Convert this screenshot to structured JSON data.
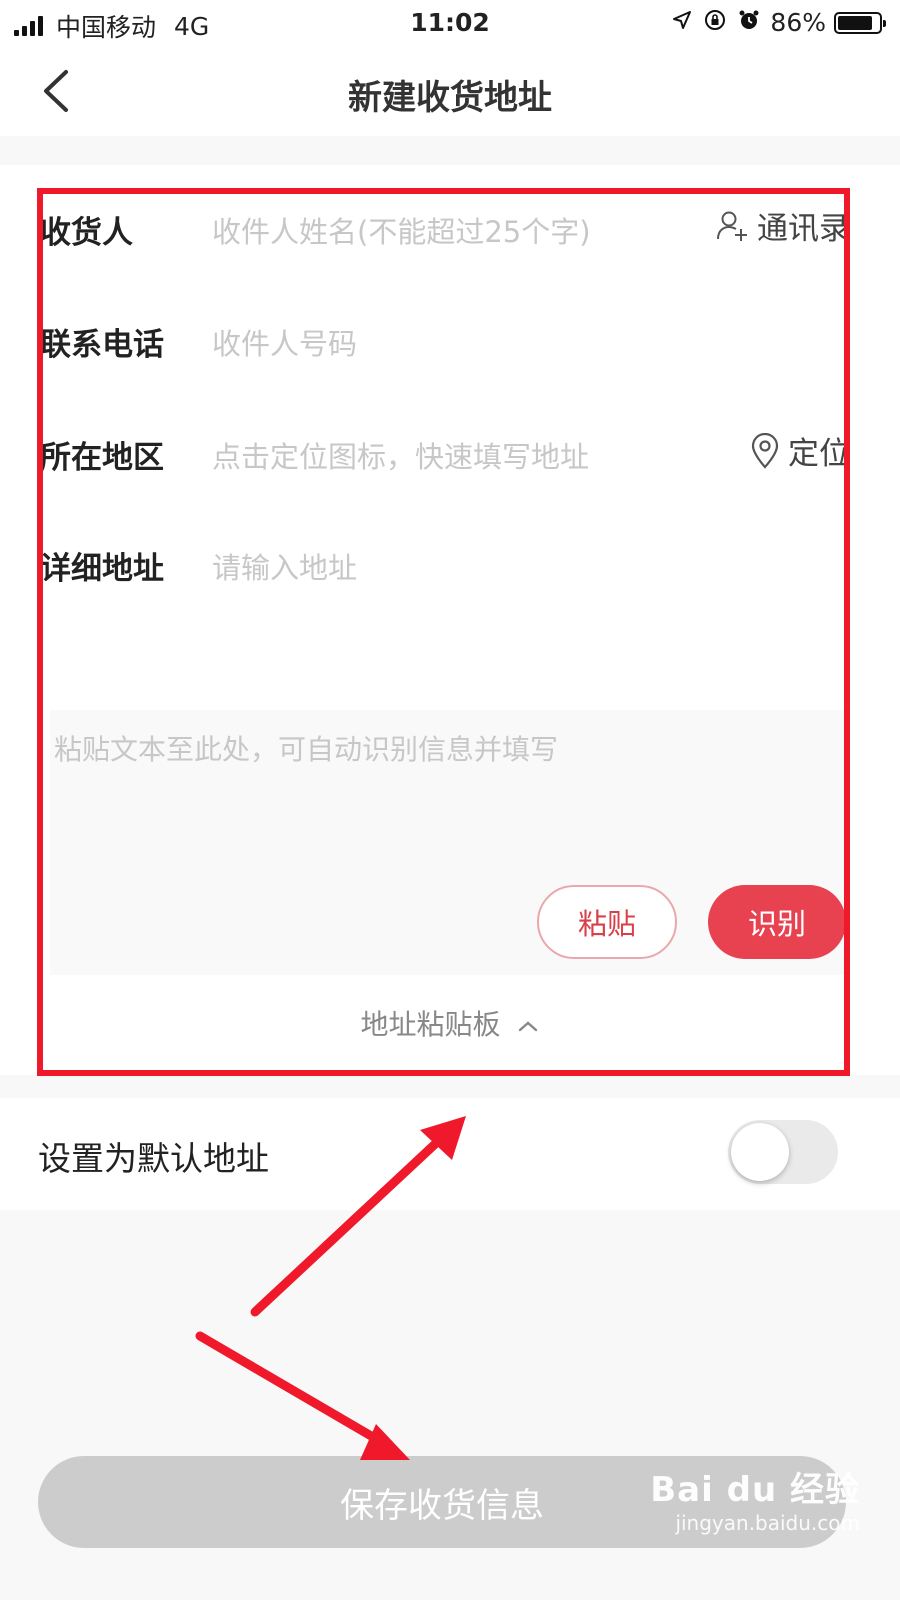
{
  "status_bar": {
    "carrier": "中国移动",
    "network": "4G",
    "time": "11:02",
    "battery": "86%",
    "battery_level": 0.86,
    "icons": [
      "location-arrow-icon",
      "orientation-lock-icon",
      "alarm-icon"
    ]
  },
  "nav": {
    "title": "新建收货地址",
    "back_icon": "chevron-left-icon"
  },
  "form": {
    "receiver": {
      "label": "收货人",
      "placeholder": "收件人姓名(不能超过25个字)",
      "action": "通讯录",
      "action_icon": "contact-add-icon"
    },
    "phone": {
      "label": "联系电话",
      "placeholder": "收件人号码"
    },
    "region": {
      "label": "所在地区",
      "placeholder": "点击定位图标，快速填写地址",
      "action": "定位",
      "action_icon": "location-pin-icon"
    },
    "detail": {
      "label": "详细地址",
      "placeholder": "请输入地址"
    }
  },
  "clipboard": {
    "hint": "粘贴文本至此处，可自动识别信息并填写",
    "paste_label": "粘贴",
    "recognize_label": "识别",
    "toggle_label": "地址粘贴板",
    "toggle_icon": "chevron-up-icon"
  },
  "default_address": {
    "label": "设置为默认地址",
    "enabled": false
  },
  "save_label": "保存收货信息",
  "watermark": {
    "logo": "Bai du 经验",
    "url": "jingyan.baidu.com"
  },
  "colors": {
    "accent": "#e84150",
    "annotation": "#f0182b",
    "placeholder": "#c7c7c7",
    "disabled_button": "#cccccc"
  }
}
